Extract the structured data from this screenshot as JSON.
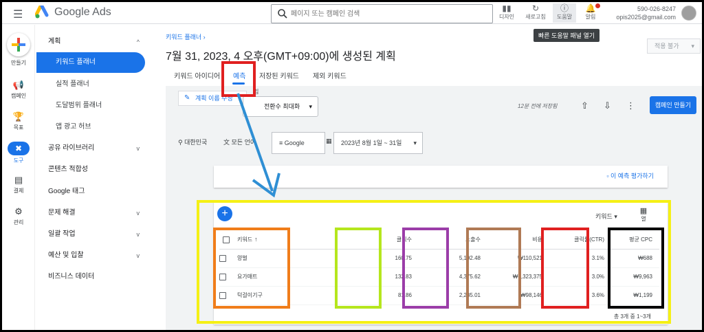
{
  "topbar": {
    "brand": "Google Ads",
    "search_placeholder": "페이지 또는 캠페인 검색",
    "buttons": [
      {
        "label": "디자인",
        "icon": "columns-icon"
      },
      {
        "label": "새로고침",
        "icon": "refresh-icon"
      },
      {
        "label": "도움말",
        "icon": "help-icon"
      },
      {
        "label": "알림",
        "icon": "bell-icon"
      }
    ],
    "account_id": "590-026-8247",
    "account_email": "opis2025@gmail.com",
    "tooltip": "빠른 도움말 패널 열기"
  },
  "rail": [
    {
      "label": "만들기",
      "icon": "plus-icon"
    },
    {
      "label": "캠페인",
      "icon": "megaphone-icon"
    },
    {
      "label": "목표",
      "icon": "trophy-icon"
    },
    {
      "label": "도구",
      "icon": "tools-icon"
    },
    {
      "label": "결제",
      "icon": "card-icon"
    },
    {
      "label": "관리",
      "icon": "gear-icon"
    }
  ],
  "nav": {
    "items": [
      {
        "label": "계획",
        "chevron": "^"
      },
      {
        "label": "키워드 플래너"
      },
      {
        "label": "실적 플래너"
      },
      {
        "label": "도달범위 플래너"
      },
      {
        "label": "앱 광고 허브"
      },
      {
        "label": "공유 라이브러리",
        "chevron": "v"
      },
      {
        "label": "콘텐츠 적합성"
      },
      {
        "label": "Google 태그"
      },
      {
        "label": "문제 해결",
        "chevron": "v"
      },
      {
        "label": "일괄 작업",
        "chevron": "v"
      },
      {
        "label": "예산 및 입찰",
        "chevron": "v"
      },
      {
        "label": "비즈니스 데이터"
      }
    ]
  },
  "main": {
    "breadcrumb": "키워드 플래너 ›",
    "title": "7월 31, 2023, 4 오후(GMT+09:00)에 생성된 계획",
    "apply_button": "적용 불가",
    "tabs": [
      "키워드 아이디어",
      "예측",
      "저장된 키워드",
      "제외 키워드"
    ],
    "rename_button": "계획 이름 수정",
    "strategy_label": "입찰 전략",
    "strategy_value": "전환수 최대화",
    "saved_text": "12분 전에 저장됨",
    "create_campaign": "캠페인 만들기",
    "filters": {
      "location": "대한민국",
      "language": "모든 언어",
      "network": "Google",
      "date_range": "2023년 8월 1일 ~ 31일"
    },
    "feedback_link": "이 예측 평가하기",
    "keyword_dropdown": "키워드",
    "columns_button": "열",
    "table": {
      "headers": [
        "키워드",
        "클릭수",
        "노출수",
        "비용",
        "클릭률(CTR)",
        "평균 CPC"
      ],
      "rows": [
        [
          "양벌",
          "160.75",
          "5,192.48",
          "₩110,521",
          "3.1%",
          "₩688"
        ],
        [
          "요가매트",
          "132.83",
          "4,375.62",
          "₩1,323,375",
          "3.0%",
          "₩9,963"
        ],
        [
          "턱걸이기구",
          "81.86",
          "2,285.01",
          "₩98,146",
          "3.6%",
          "₩1,199"
        ]
      ]
    },
    "total": "총 3개 중 1~3개"
  },
  "colors": {
    "accent": "#1a73e8",
    "annotation_red": "#e02020",
    "annotation_yellow": "#f5f015",
    "annotation_orange": "#f07d1a",
    "annotation_green": "#b5e61d",
    "annotation_purple": "#9b3da8",
    "annotation_brown": "#b07a55",
    "annotation_black": "#000000",
    "arrow": "#2f8fd4"
  }
}
